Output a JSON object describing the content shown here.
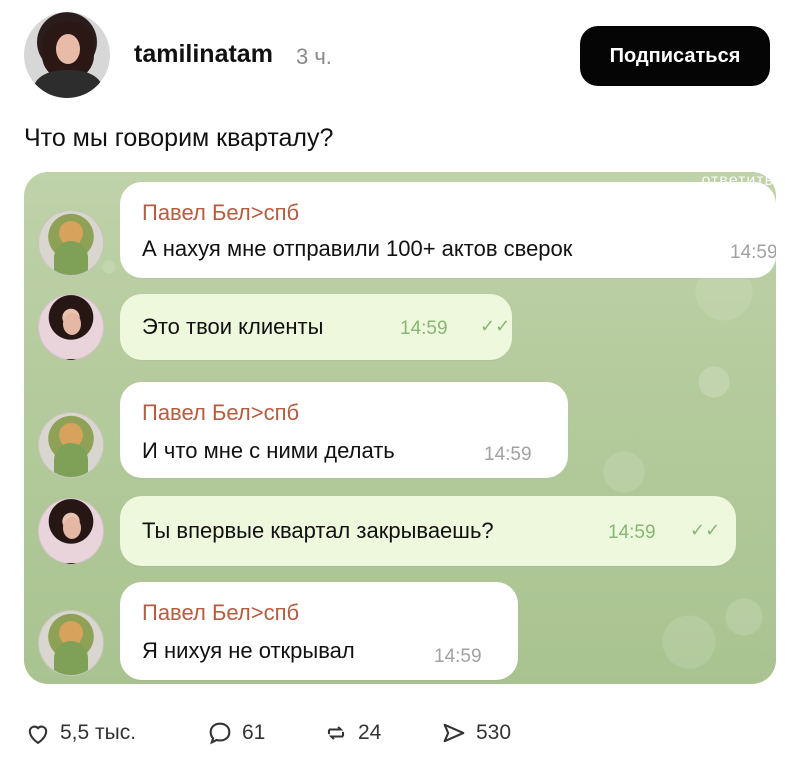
{
  "post": {
    "username": "tamilinatam",
    "time_ago": "3 ч.",
    "subscribe_label": "Подписаться",
    "caption": "Что мы говорим кварталу?"
  },
  "chat": {
    "top_hint": "ответить",
    "messages": [
      {
        "sender": "Павел Бел>спб",
        "text": "А нахуя мне отправили 100+ актов сверок",
        "time": "14:59",
        "direction": "in"
      },
      {
        "text": "Это твои клиенты",
        "time": "14:59",
        "direction": "out",
        "read_mark": "✓✓"
      },
      {
        "sender": "Павел Бел>спб",
        "text": "И что мне с ними делать",
        "time": "14:59",
        "direction": "in"
      },
      {
        "text": "Ты впервые квартал закрываешь?",
        "time": "14:59",
        "direction": "out",
        "read_mark": "✓✓"
      },
      {
        "sender": "Павел Бел>спб",
        "text": "Я нихуя не открывал",
        "time": "14:59",
        "direction": "in"
      }
    ]
  },
  "actions": {
    "likes": "5,5 тыс.",
    "comments": "61",
    "reposts": "24",
    "shares": "530"
  },
  "icons": {
    "like": "heart-icon",
    "comment": "comment-icon",
    "repost": "repost-icon",
    "share": "share-icon"
  }
}
